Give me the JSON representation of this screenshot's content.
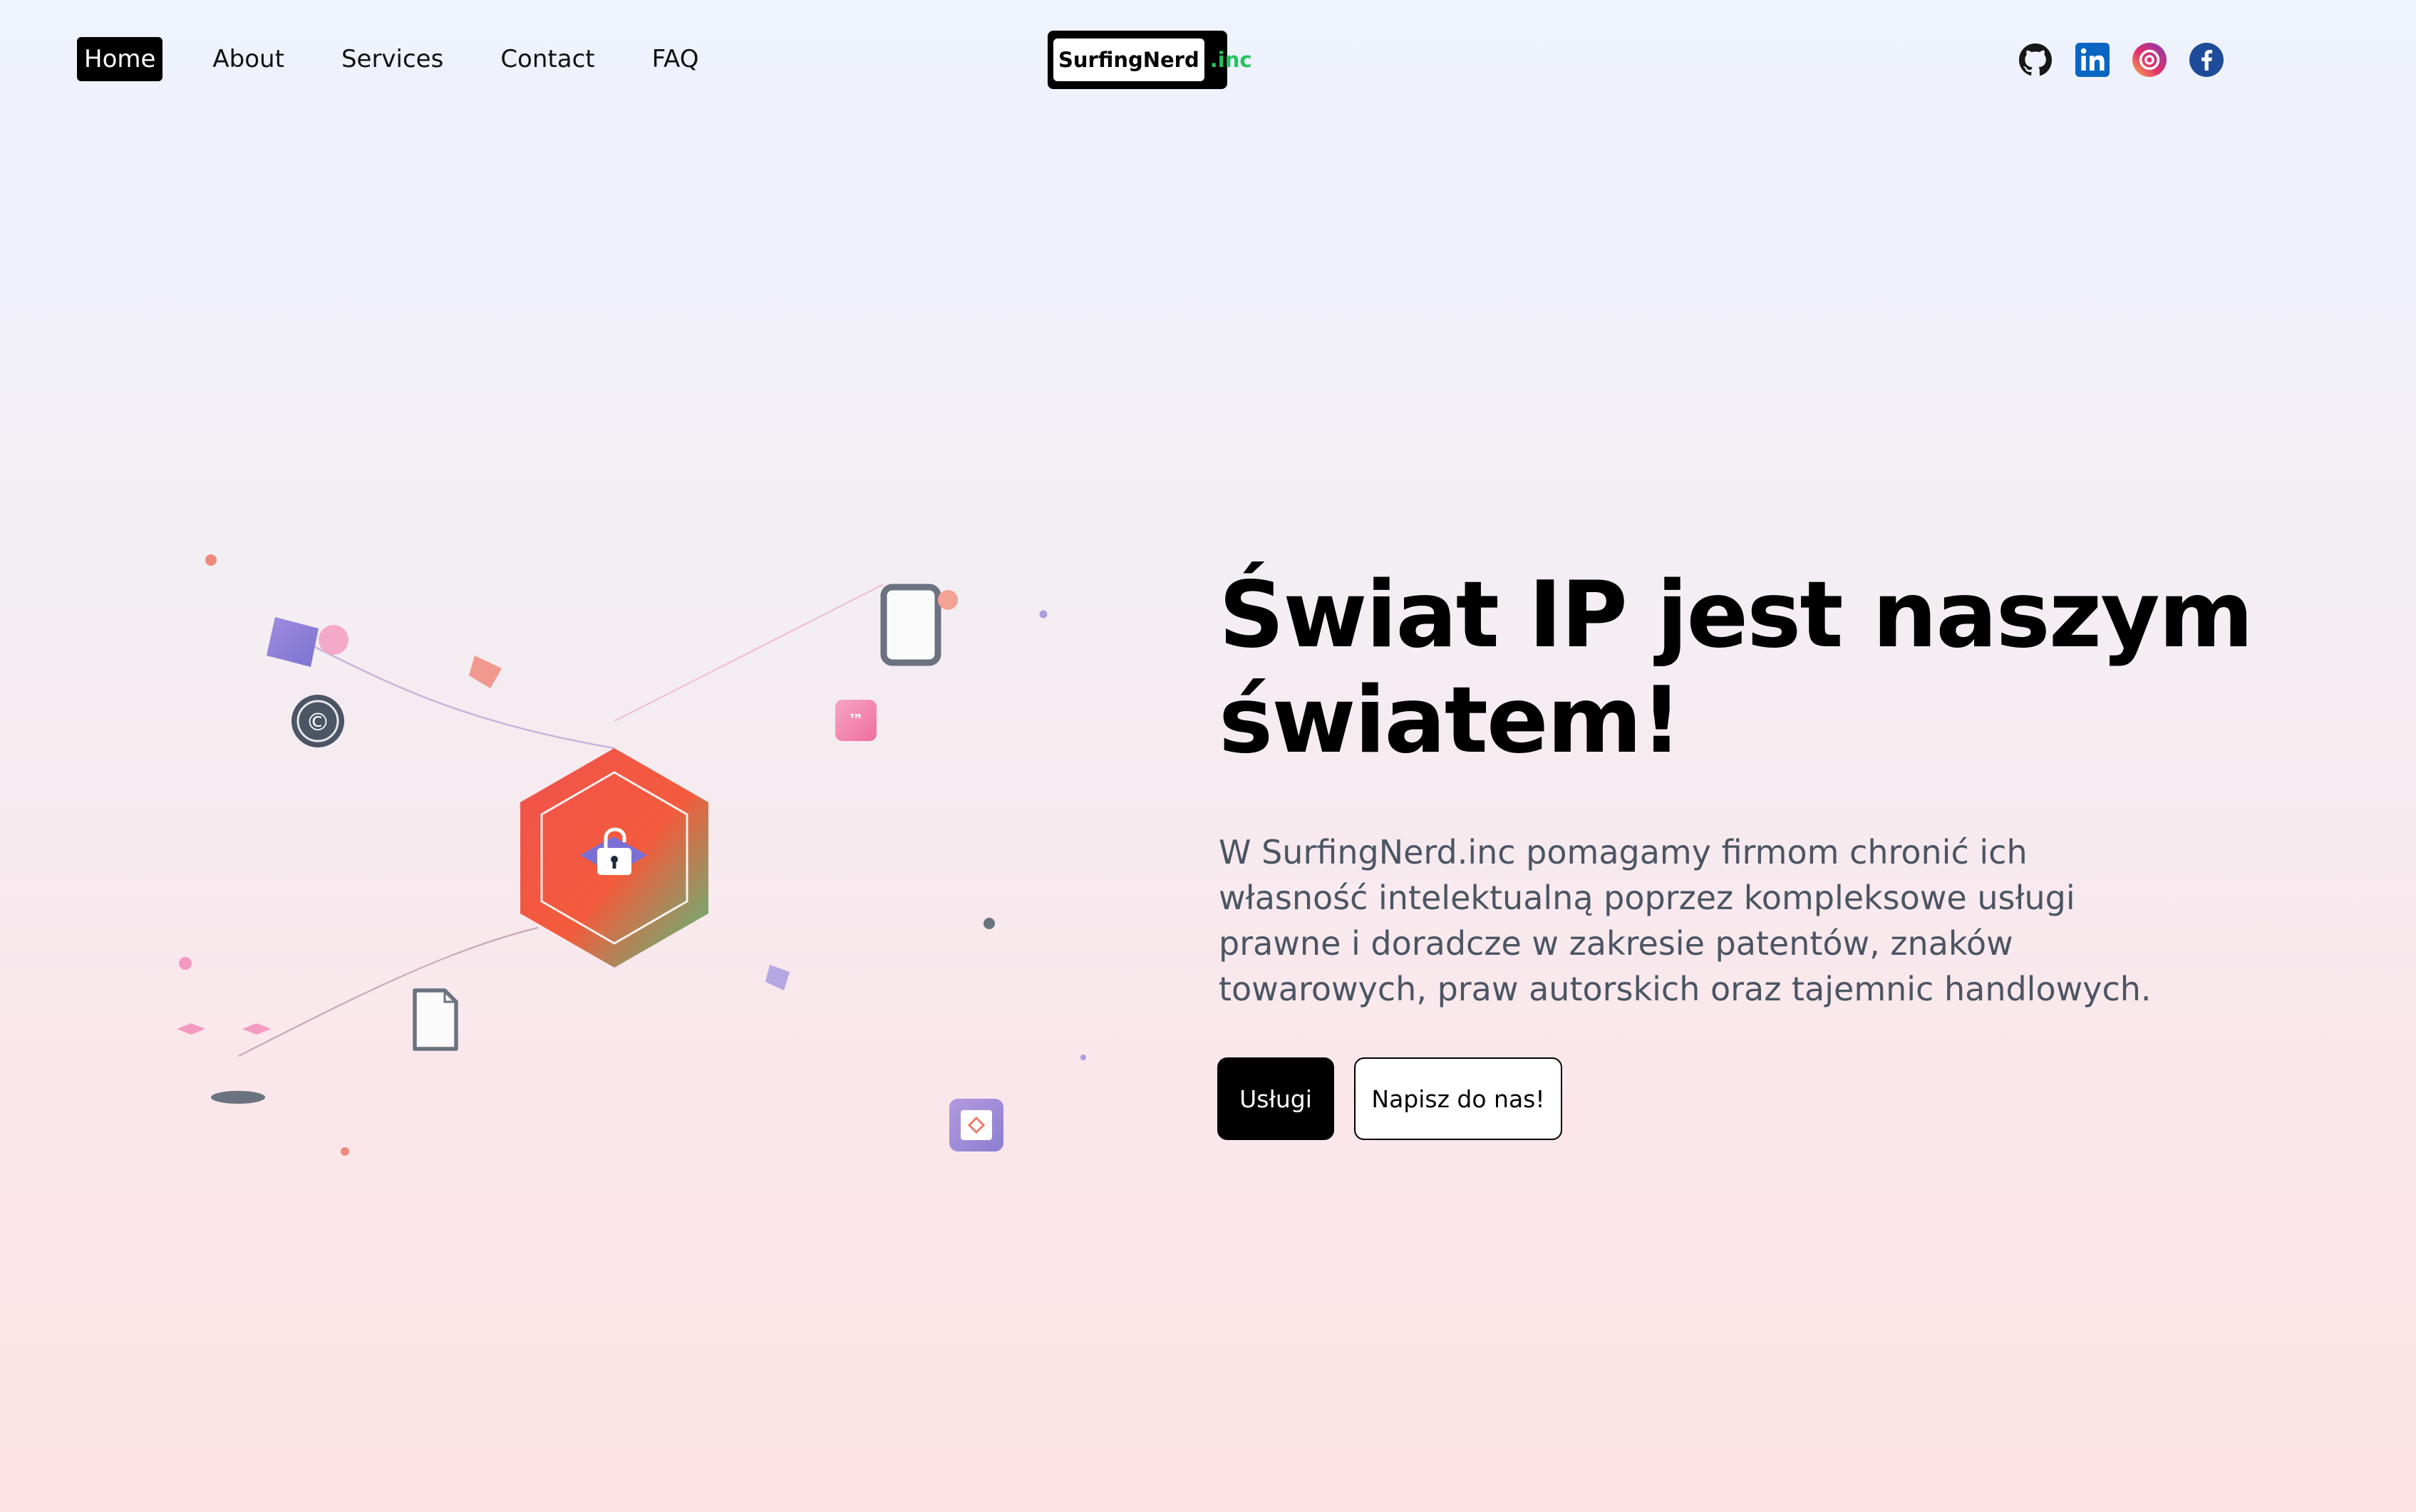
{
  "nav": {
    "items": [
      {
        "label": "Home",
        "active": true
      },
      {
        "label": "About",
        "active": false
      },
      {
        "label": "Services",
        "active": false
      },
      {
        "label": "Contact",
        "active": false
      },
      {
        "label": "FAQ",
        "active": false
      }
    ]
  },
  "brand": {
    "name": "SurfingNerd",
    "suffix": ".inc"
  },
  "social": {
    "items": [
      "github-icon",
      "linkedin-icon",
      "instagram-icon",
      "facebook-icon"
    ]
  },
  "hero": {
    "title_line1": "Świat IP jest naszym",
    "title_line2": "światem!",
    "description": "W SurfingNerd.inc pomagamy firmom chronić ich własność intelektualną poprzez kompleksowe usługi prawne i doradcze w zakresie patentów, znaków towarowych, praw autorskich oraz tajemnic handlowych.",
    "primary_button": "Usługi",
    "secondary_button": "Napisz do nas!"
  },
  "illustration": {
    "copyright_symbol": "©",
    "trademark_symbol": "™"
  },
  "colors": {
    "accent_green": "#22c55e",
    "text_gray": "#4b5563",
    "hexagon_red": "#f0524d",
    "hexagon_green": "#55b878",
    "purple": "#8b7fd4",
    "pink": "#f49ac1"
  }
}
